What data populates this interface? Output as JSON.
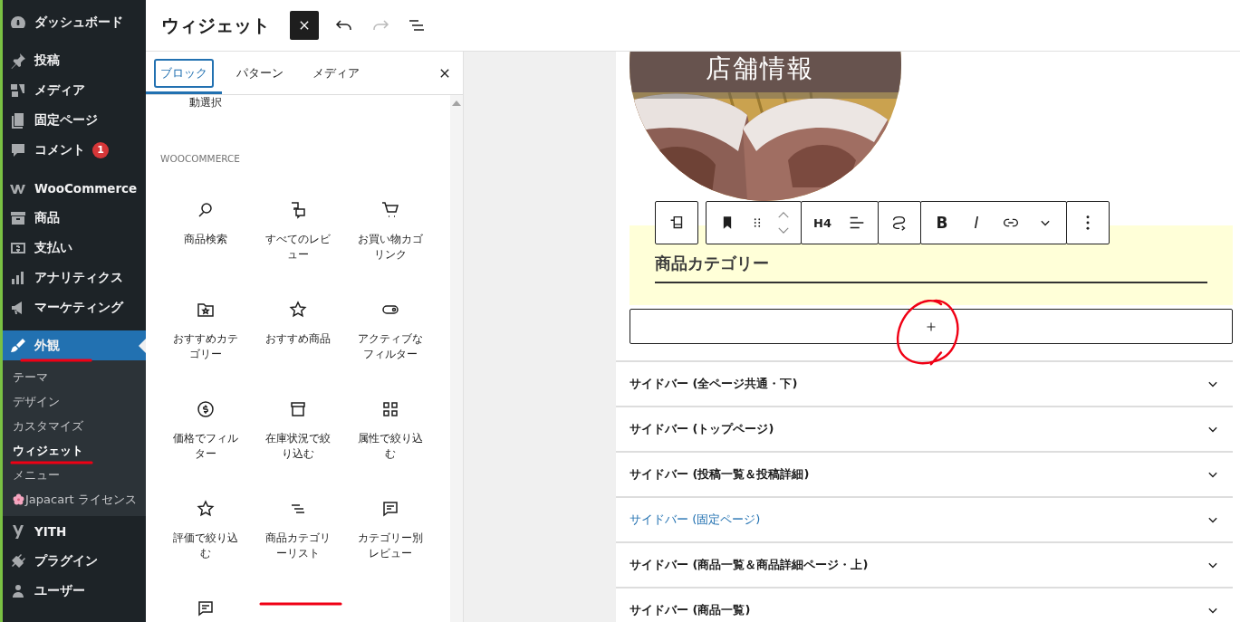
{
  "sidebar": {
    "items": [
      {
        "label": "ダッシュボード",
        "current": false,
        "annotated": false
      },
      {
        "label": "投稿",
        "current": false,
        "annotated": false
      },
      {
        "label": "メディア",
        "current": false,
        "annotated": false
      },
      {
        "label": "固定ページ",
        "current": false,
        "annotated": false
      },
      {
        "label": "コメント",
        "badge": "1",
        "current": false,
        "annotated": false
      },
      {
        "label": "WooCommerce",
        "current": false,
        "annotated": false
      },
      {
        "label": "商品",
        "current": false,
        "annotated": false
      },
      {
        "label": "支払い",
        "current": false,
        "annotated": false
      },
      {
        "label": "アナリティクス",
        "current": false,
        "annotated": false
      },
      {
        "label": "マーケティング",
        "current": false,
        "annotated": false
      },
      {
        "label": "外観",
        "current": true,
        "annotated": true,
        "children": [
          {
            "label": "テーマ",
            "selected": false,
            "annotated": false
          },
          {
            "label": "デザイン",
            "selected": false,
            "annotated": false
          },
          {
            "label": "カスタマイズ",
            "selected": false,
            "annotated": false
          },
          {
            "label": "ウィジェット",
            "selected": true,
            "annotated": true
          },
          {
            "label": "メニュー",
            "selected": false,
            "annotated": false
          },
          {
            "label": "Japacart ライセンス",
            "selected": false,
            "annotated": false
          }
        ]
      },
      {
        "label": "YITH",
        "current": false,
        "annotated": false
      },
      {
        "label": "プラグイン",
        "current": false,
        "annotated": false
      },
      {
        "label": "ユーザー",
        "current": false,
        "annotated": false
      }
    ]
  },
  "header": {
    "title": "ウィジェット",
    "redo_disabled": true
  },
  "inserter": {
    "tabs": [
      {
        "label": "ブロック",
        "selected": true
      },
      {
        "label": "パターン",
        "selected": false
      },
      {
        "label": "メディア",
        "selected": false
      }
    ],
    "partial_label": "動選択",
    "section_title": "WOOCOMMERCE",
    "blocks": [
      {
        "label": "商品検索",
        "annotated": false
      },
      {
        "label": "すべてのレビュー",
        "annotated": false
      },
      {
        "label": "お買い物カゴリンク",
        "annotated": false
      },
      {
        "label": "おすすめカテゴリー",
        "annotated": false
      },
      {
        "label": "おすすめ商品",
        "annotated": false
      },
      {
        "label": "アクティブなフィルター",
        "annotated": false
      },
      {
        "label": "価格でフィルター",
        "annotated": false
      },
      {
        "label": "在庫状況で絞り込む",
        "annotated": false
      },
      {
        "label": "属性で絞り込む",
        "annotated": false
      },
      {
        "label": "評価で絞り込む",
        "annotated": false
      },
      {
        "label": "商品カテゴリーリスト",
        "annotated": true
      },
      {
        "label": "カテゴリー別レビュー",
        "annotated": false
      },
      {
        "annotated": false
      }
    ]
  },
  "canvas": {
    "cover": {
      "title": "店舗情報"
    },
    "toolbar": {
      "heading_level": "H4",
      "bold": "B",
      "italic": "I"
    },
    "heading": "商品カテゴリー",
    "add_block": {
      "annotated": true
    },
    "areas": [
      {
        "label": "サイドバー (全ページ共通・下)",
        "selected": false
      },
      {
        "label": "サイドバー (トップページ)",
        "selected": false
      },
      {
        "label": "サイドバー (投稿一覧＆投稿詳細)",
        "selected": false
      },
      {
        "label": "サイドバー (固定ページ)",
        "selected": true
      },
      {
        "label": "サイドバー (商品一覧＆商品詳細ページ・上)",
        "selected": false
      },
      {
        "label": "サイドバー (商品一覧)",
        "selected": false
      }
    ]
  }
}
